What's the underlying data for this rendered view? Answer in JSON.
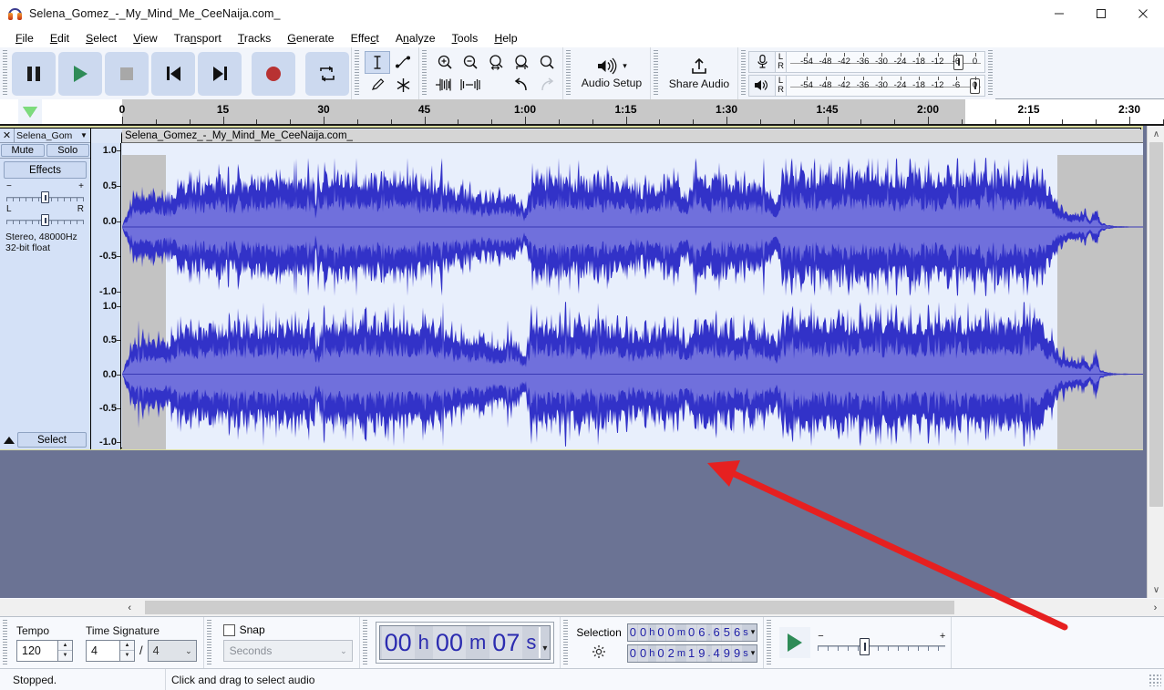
{
  "window": {
    "title": "Selena_Gomez_-_My_Mind_Me_CeeNaija.com_",
    "app_icon": "audacity-headphones-icon",
    "minimize": "—",
    "maximize": "☐",
    "close": "✕"
  },
  "menubar": {
    "items": [
      {
        "label": "File"
      },
      {
        "label": "Edit"
      },
      {
        "label": "Select"
      },
      {
        "label": "View"
      },
      {
        "label": "Transport"
      },
      {
        "label": "Tracks"
      },
      {
        "label": "Generate"
      },
      {
        "label": "Effect"
      },
      {
        "label": "Analyze"
      },
      {
        "label": "Tools"
      },
      {
        "label": "Help"
      }
    ]
  },
  "transport": {
    "buttons": [
      {
        "name": "pause-button",
        "label": "Pause"
      },
      {
        "name": "play-button",
        "label": "Play"
      },
      {
        "name": "stop-button",
        "label": "Stop"
      },
      {
        "name": "skip-to-start-button",
        "label": "Skip to Start"
      },
      {
        "name": "skip-to-end-button",
        "label": "Skip to End"
      },
      {
        "name": "record-button",
        "label": "Record"
      },
      {
        "name": "loop-button",
        "label": "Loop"
      }
    ]
  },
  "tools": {
    "selection": "selection-tool",
    "envelope": "envelope-tool",
    "draw": "draw-tool",
    "multi": "multi-tool",
    "selected": "selection-tool"
  },
  "edit_toolbar": {
    "zoom_in": "zoom-in",
    "zoom_out": "zoom-out",
    "fit_selection": "fit-selection-to-width",
    "fit_project": "fit-project-to-width",
    "zoom_toggle": "zoom-toggle",
    "trim_audio": "trim-audio-outside-selection",
    "silence_audio": "silence-audio-selection",
    "undo": "undo",
    "redo": "redo"
  },
  "audio_setup": {
    "label": "Audio Setup",
    "icon": "speaker-icon",
    "caret": "▾"
  },
  "share_audio": {
    "label": "Share Audio",
    "icon": "upload-icon"
  },
  "meters": {
    "record": {
      "icon": "microphone-icon",
      "left": "L",
      "right": "R",
      "ticks": [
        "-54",
        "-48",
        "-42",
        "-36",
        "-30",
        "-24",
        "-18",
        "-12",
        "-6",
        "0"
      ]
    },
    "playback": {
      "icon": "speaker-icon",
      "left": "L",
      "right": "R",
      "ticks": [
        "-54",
        "-48",
        "-42",
        "-36",
        "-30",
        "-24",
        "-18",
        "-12",
        "-6",
        "0"
      ]
    }
  },
  "ruler": {
    "labels": [
      "0",
      "15",
      "30",
      "45",
      "1:00",
      "1:15",
      "1:30",
      "1:45",
      "2:00",
      "2:15",
      "2:30"
    ],
    "pin_icon": "timeline-pinned-play-head"
  },
  "track": {
    "close_icon": "✕",
    "name": "Selena_Gom",
    "dropdown_caret": "▼",
    "mute_label": "Mute",
    "solo_label": "Solo",
    "effects_label": "Effects",
    "gain_minus": "−",
    "gain_plus": "+",
    "pan_left": "L",
    "pan_right": "R",
    "info_line1": "Stereo, 48000Hz",
    "info_line2": "32-bit float",
    "select_label": "Select",
    "collapse_icon": "triangle-up-icon",
    "clip_title": "Selena_Gomez_-_My_Mind_Me_CeeNaija.com_",
    "vertical_ruler_labels": [
      "1.0",
      "0.5",
      "0.0",
      "-0.5",
      "-1.0"
    ],
    "waveform_color": "#3232c8",
    "rms_color": "#7070dc",
    "selected_bg": "#e8effc",
    "unselected_bg": "#c3c3c3"
  },
  "bottom": {
    "tempo_label": "Tempo",
    "tempo_value": "120",
    "time_signature_label": "Time Signature",
    "time_sig_upper": "4",
    "time_sig_slash": "/",
    "time_sig_lower": "4",
    "snap_label": "Snap",
    "snap_checked": false,
    "snap_value": "Seconds",
    "audio_position": {
      "hours": "00",
      "h_unit": "h",
      "minutes": "00",
      "m_unit": "m",
      "seconds": "07",
      "s_unit": "s",
      "caret": "▾"
    },
    "selection_label": "Selection",
    "settings_icon": "gear-icon",
    "selection_start": {
      "digits": [
        "0",
        "0",
        "h",
        "0",
        "0",
        "m",
        "0",
        "6",
        ".",
        "6",
        "5",
        "6",
        "s"
      ],
      "text": "00 h 00 m 06.656 s"
    },
    "selection_end": {
      "digits": [
        "0",
        "0",
        "h",
        "0",
        "2",
        "m",
        "1",
        "9",
        ".",
        "4",
        "9",
        "9",
        "s"
      ],
      "text": "00 h 02 m 19.499 s"
    },
    "play_at_speed": {
      "icon": "play-at-speed-icon",
      "minus": "−",
      "plus": "+"
    }
  },
  "statusbar": {
    "state": "Stopped.",
    "hint": "Click and drag to select audio"
  },
  "annotation": {
    "arrow_color": "#e62020",
    "arrow": "red-pointer-arrow"
  },
  "scrollbars": {
    "v_up": "∧",
    "v_down": "∨",
    "h_left": "‹",
    "h_right": "›"
  }
}
